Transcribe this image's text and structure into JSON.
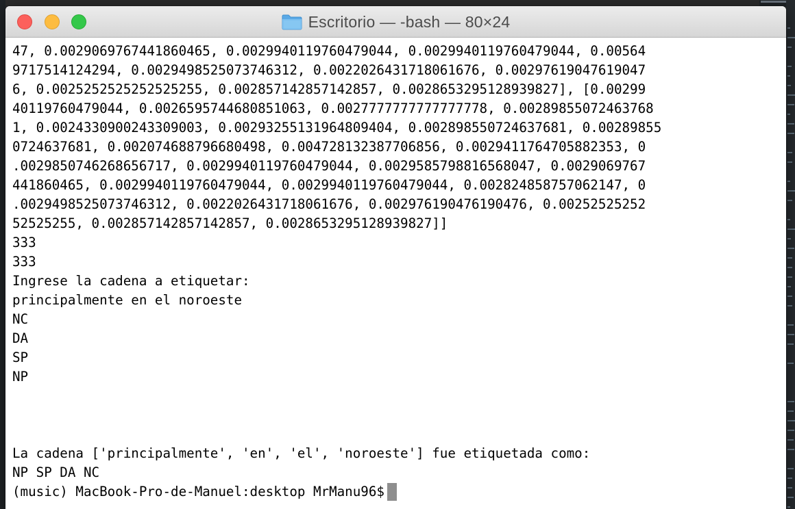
{
  "window": {
    "title": "Escritorio — -bash — 80×24"
  },
  "icons": {
    "title_icon": "folder-icon",
    "close": "close-button",
    "minimize": "minimize-button",
    "zoom": "zoom-button"
  },
  "colors": {
    "close": "#fc605c",
    "minimize": "#fdbc40",
    "zoom": "#34c84a",
    "terminal_bg": "#ffffff",
    "terminal_fg": "#000000",
    "cursor": "#8e8e8e",
    "folder": "#5aa9e6"
  },
  "terminal": {
    "lines": [
      "47, 0.002906976744186046​5, 0.002994011976047904​4, 0.002994011976047904​4, 0.00564",
      "9717514124294, 0.0029498525073746312, 0.0022026431718061676, 0.00297619047619047",
      "6, 0.0025252525252525255, 0.002857142857142857, 0.002865329512893982​7], [0.00299",
      "4011976047904​4, 0.0026595744680851063, 0.0027777777777777778, 0.00289855072463768",
      "1, 0.0024330900243309003, 0.0029325513196480940​4, 0.002898550724637681, 0.00289855",
      "0724637681, 0.0020746887966804​98, 0.004728132387706856, 0.0029411764705882353, 0",
      ".0029850746268656717, 0.0029940119760479044, 0.0029585798816568047, 0.0029069767",
      "441860465, 0.0029940119760479044, 0.0029940119760479044, 0.0028248587570621​47, 0",
      ".0029498525073746312, 0.0022026431718061676, 0.00297619047619047​6, 0.00252525252",
      "52525255, 0.002857142857142857, 0.0028653295128939827]]",
      "333",
      "333",
      "Ingrese la cadena a etiquetar:",
      "principalmente en el noroeste",
      "NC",
      "DA",
      "SP",
      "NP",
      "",
      "",
      "",
      "La cadena ['principalmente', 'en', 'el', 'noroeste'] fue etiquetada como:",
      "NP SP DA NC"
    ],
    "prompt": "(music) MacBook-Pro-de-Manuel:desktop MrManu96$"
  }
}
